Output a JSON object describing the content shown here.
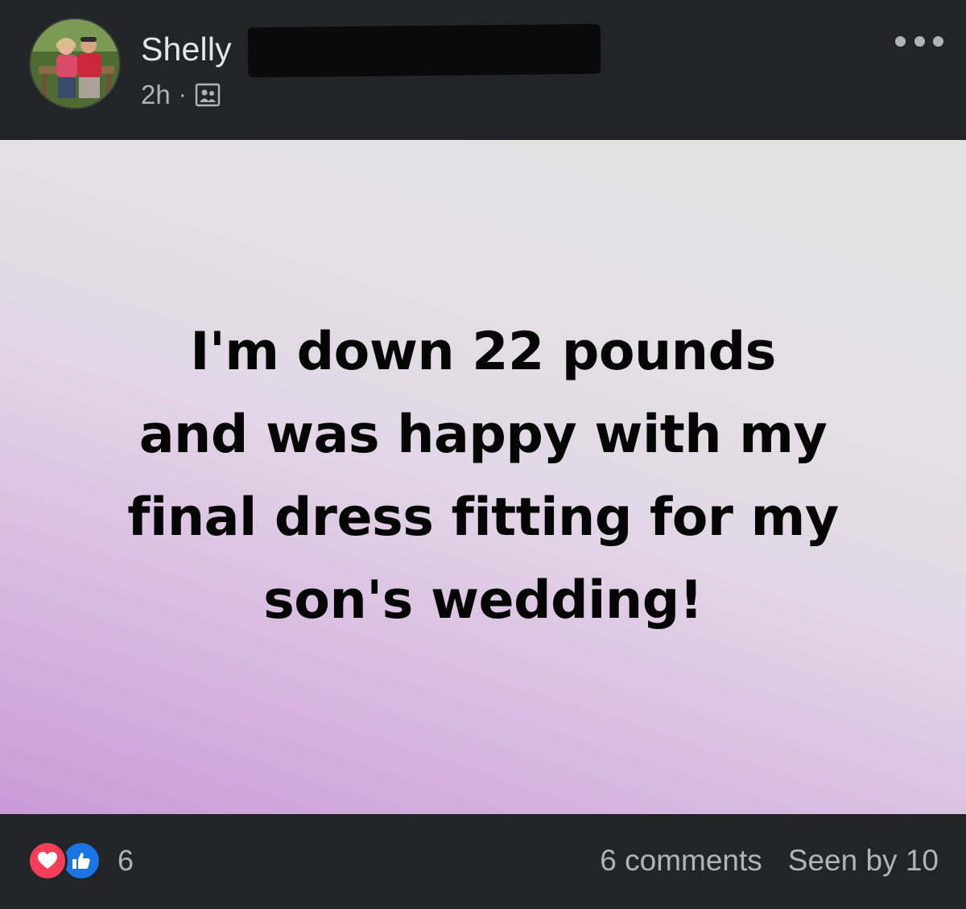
{
  "post": {
    "author_name": "Shelly",
    "timestamp": "2h",
    "meta_separator": "·",
    "audience": "friends-icon",
    "more_options": "more-options-icon"
  },
  "status": {
    "lines": [
      "I'm down 22 pounds",
      "and was happy with my",
      "final dress fitting for my",
      "son's wedding!"
    ]
  },
  "footer": {
    "reactions": [
      "love-icon",
      "like-icon"
    ],
    "reaction_count": "6",
    "comments": "6 comments",
    "seen_by": "Seen by 10"
  },
  "colors": {
    "background": "#232427",
    "text_primary": "#e4e6eb",
    "text_secondary": "#b0b3b8",
    "love": "#f33e58",
    "like": "#1b74e4",
    "card_purple": "#c99ad6",
    "card_gray": "#e1e1e1"
  }
}
